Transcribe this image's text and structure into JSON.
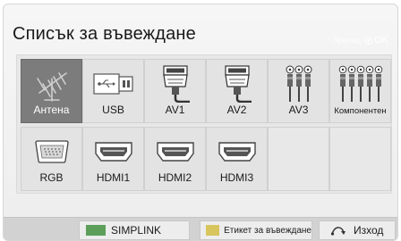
{
  "menu": {
    "title": "Списък за въвеждане",
    "hint_move": "Преглед",
    "hint_ok": "OK"
  },
  "inputs": [
    {
      "label": "Антена",
      "icon": "antenna-icon",
      "selected": true
    },
    {
      "label": "USB",
      "icon": "usb-icon",
      "selected": false
    },
    {
      "label": "AV1",
      "icon": "scart-icon",
      "selected": false
    },
    {
      "label": "AV2",
      "icon": "scart-icon",
      "selected": false
    },
    {
      "label": "AV3",
      "icon": "rca-cable-icon",
      "selected": false
    },
    {
      "label": "Компонентен",
      "icon": "component-cable-icon",
      "selected": false
    },
    {
      "label": "RGB",
      "icon": "vga-port-icon",
      "selected": false
    },
    {
      "label": "HDMI1",
      "icon": "hdmi-port-icon",
      "selected": false
    },
    {
      "label": "HDMI2",
      "icon": "hdmi-port-icon",
      "selected": false
    },
    {
      "label": "HDMI3",
      "icon": "hdmi-port-icon",
      "selected": false
    }
  ],
  "bottom_bar": {
    "simplink_label": "SIMPLINK",
    "rename_label": "Етикет за въвеждане",
    "exit_label": "Изход"
  },
  "colors": {
    "selected_tile": "#7c7c7c",
    "key_green": "#5c9f5a",
    "key_yellow": "#d8c55e"
  }
}
